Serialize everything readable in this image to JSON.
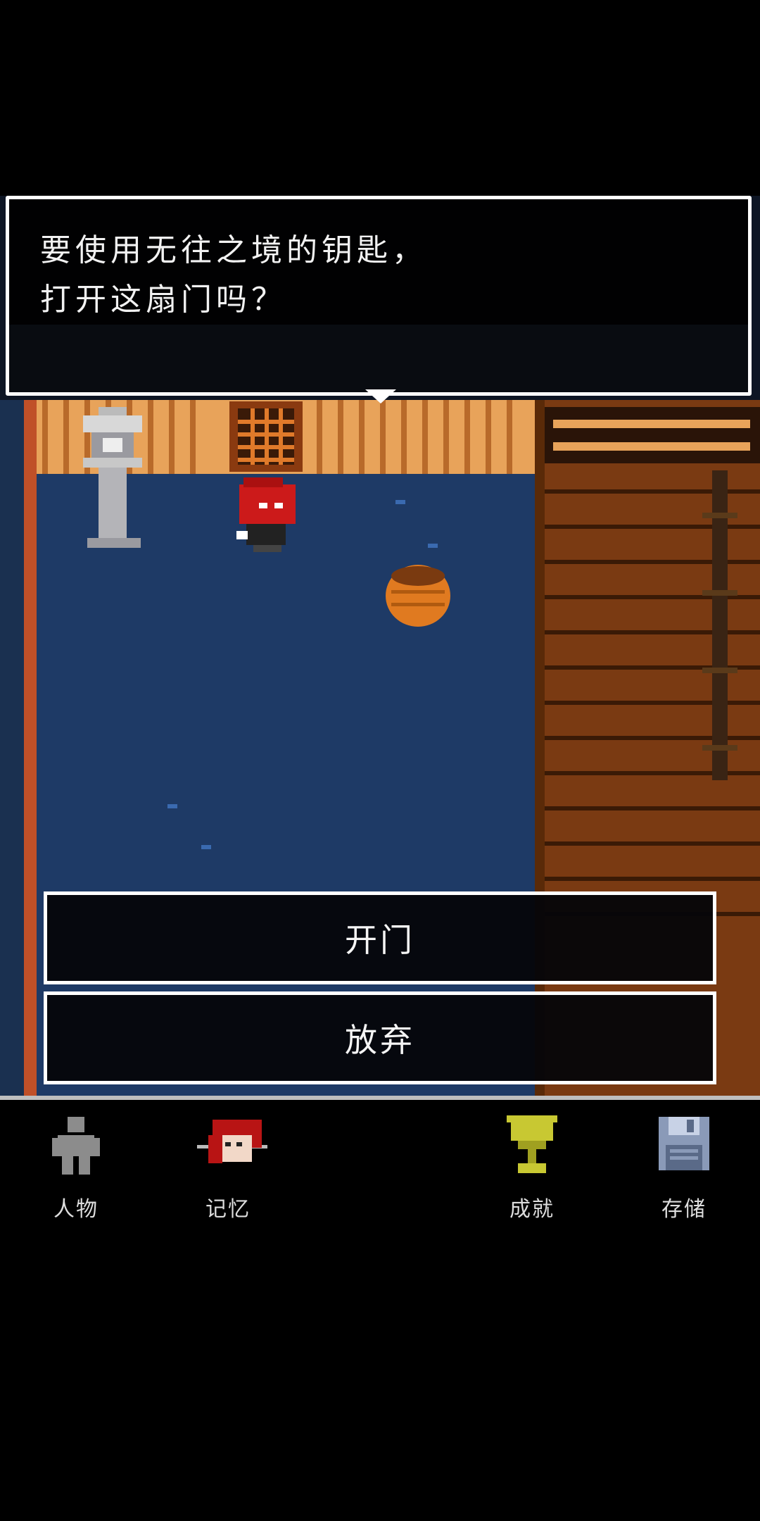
{
  "dialog": {
    "line1": "要使用无往之境的钥匙，",
    "line2": "打开这扇门吗？"
  },
  "choices": [
    {
      "label": "开门"
    },
    {
      "label": "放弃"
    }
  ],
  "nav": [
    {
      "label": "人物",
      "icon": "person-icon"
    },
    {
      "label": "记忆",
      "icon": "memory-portrait-icon"
    },
    {
      "label": "成就",
      "icon": "trophy-icon"
    },
    {
      "label": "存储",
      "icon": "floppy-disk-icon"
    }
  ],
  "colors": {
    "floor": "#1e3a66",
    "wall": "#e8a35a",
    "brick": "#7a3a12",
    "trophy": "#c8c832",
    "floppy": "#8a9ab8"
  }
}
